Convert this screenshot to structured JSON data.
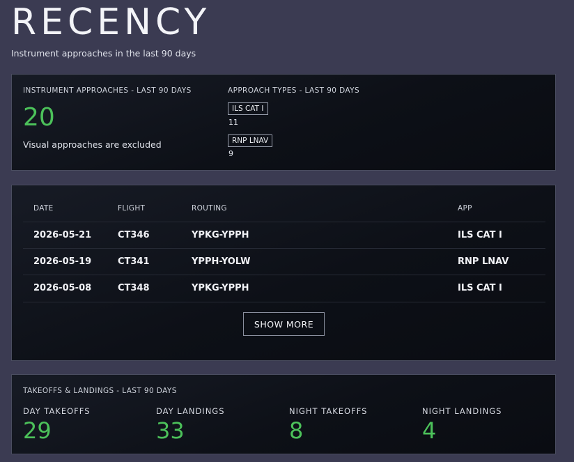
{
  "header": {
    "title": "RECENCY",
    "subtitle": "Instrument approaches in the last 90 days"
  },
  "approaches": {
    "label": "INSTRUMENT APPROACHES - LAST 90 DAYS",
    "count": "20",
    "note": "Visual approaches are excluded",
    "types_label": "APPROACH TYPES - LAST 90 DAYS",
    "types": [
      {
        "name": "ILS CAT I",
        "count": "11"
      },
      {
        "name": "RNP LNAV",
        "count": "9"
      }
    ]
  },
  "table": {
    "columns": [
      "DATE",
      "FLIGHT",
      "ROUTING",
      "APP"
    ],
    "rows": [
      {
        "date": "2026-05-21",
        "flight": "CT346",
        "routing": "YPKG-YPPH",
        "app": "ILS CAT I"
      },
      {
        "date": "2026-05-19",
        "flight": "CT341",
        "routing": "YPPH-YOLW",
        "app": "RNP LNAV"
      },
      {
        "date": "2026-05-08",
        "flight": "CT348",
        "routing": "YPKG-YPPH",
        "app": "ILS CAT I"
      }
    ],
    "show_more_label": "SHOW MORE"
  },
  "takeoffs_landings": {
    "label": "TAKEOFFS & LANDINGS - LAST 90 DAYS",
    "stats": [
      {
        "label": "DAY TAKEOFFS",
        "value": "29"
      },
      {
        "label": "DAY LANDINGS",
        "value": "33"
      },
      {
        "label": "NIGHT TAKEOFFS",
        "value": "8"
      },
      {
        "label": "NIGHT LANDINGS",
        "value": "4"
      }
    ]
  },
  "colors": {
    "accent_green": "#4cc15a",
    "background": "#3b3b52",
    "card": "#0d1017"
  }
}
